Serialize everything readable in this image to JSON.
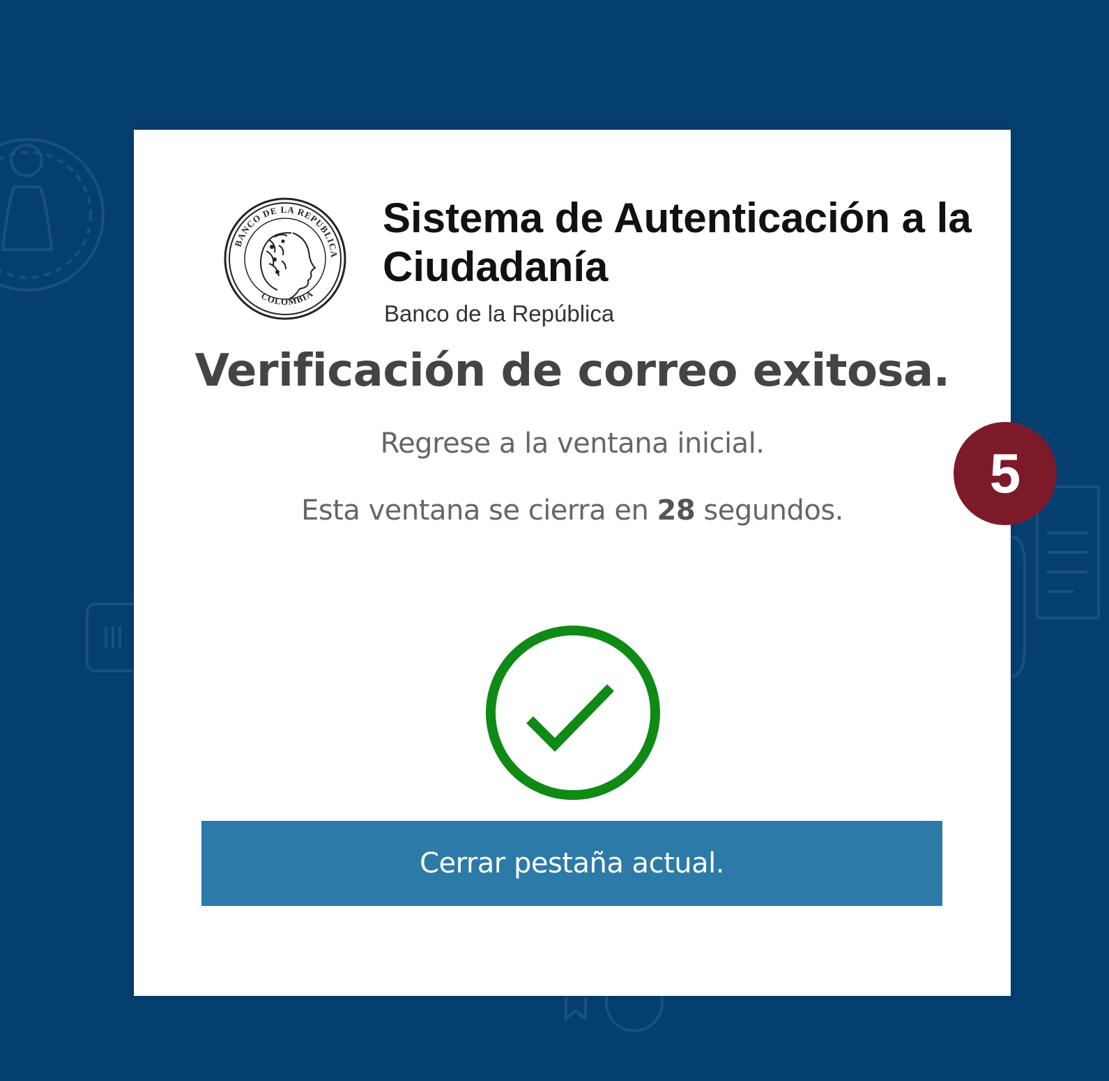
{
  "brand": {
    "title": "Sistema de Autenticación a la Ciudadanía",
    "subtitle": "Banco de la República",
    "seal_text": "BANCO DE LA REPUBLICA · COLOMBIA"
  },
  "message": {
    "heading": "Verificación de correo exitosa.",
    "instruction": "Regrese a la ventana inicial.",
    "countdown_prefix": "Esta ventana se cierra en",
    "countdown_seconds": "28",
    "countdown_suffix": "segundos."
  },
  "actions": {
    "close_tab_label": "Cerrar pestaña actual."
  },
  "annotation": {
    "step_number": "5"
  },
  "colors": {
    "background": "#053f70",
    "card": "#ffffff",
    "button": "#2b7aa8",
    "success": "#0f8a15",
    "step_badge": "#7d1a2a"
  },
  "icons": {
    "success": "check-circle-icon",
    "logo": "bank-seal-logo"
  }
}
